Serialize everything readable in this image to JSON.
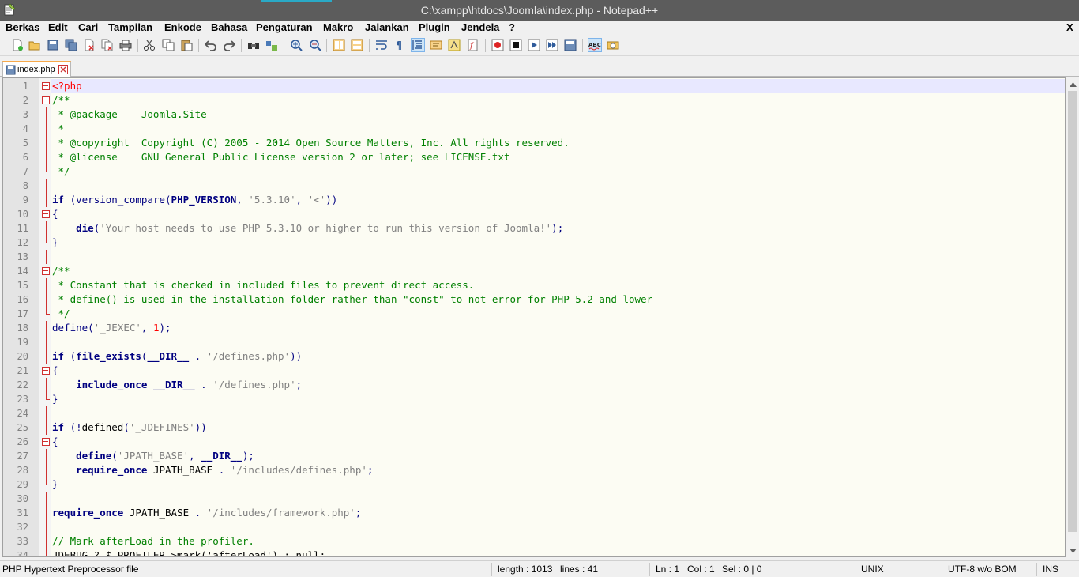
{
  "window": {
    "title": "C:\\xampp\\htdocs\\Joomla\\index.php - Notepad++",
    "close_label": "X"
  },
  "menu": [
    "Berkas",
    "Edit",
    "Cari",
    "Tampilan",
    "Enkode",
    "Bahasa",
    "Pengaturan",
    "Makro",
    "Jalankan",
    "Plugin",
    "Jendela",
    "?"
  ],
  "tab": {
    "label": "index.php"
  },
  "editor": {
    "lines": [
      {
        "n": "1",
        "fold": "start",
        "t": [
          [
            "tg",
            "<?php"
          ]
        ]
      },
      {
        "n": "2",
        "fold": "start",
        "t": [
          [
            "cm",
            "/**"
          ]
        ]
      },
      {
        "n": "3",
        "fold": "line",
        "t": [
          [
            "cm",
            " * @package    Joomla.Site"
          ]
        ]
      },
      {
        "n": "4",
        "fold": "line",
        "t": [
          [
            "cm",
            " *"
          ]
        ]
      },
      {
        "n": "5",
        "fold": "line",
        "t": [
          [
            "cm",
            " * @copyright  Copyright (C) 2005 - 2014 Open Source Matters, Inc. All rights reserved."
          ]
        ]
      },
      {
        "n": "6",
        "fold": "line",
        "t": [
          [
            "cm",
            " * @license    GNU General Public License version 2 or later; see LICENSE.txt"
          ]
        ]
      },
      {
        "n": "7",
        "fold": "end",
        "t": [
          [
            "cm",
            " */"
          ]
        ]
      },
      {
        "n": "8",
        "fold": "line",
        "t": []
      },
      {
        "n": "9",
        "fold": "line",
        "t": [
          [
            "kw",
            "if"
          ],
          [
            "df",
            " "
          ],
          [
            "op",
            "("
          ],
          [
            "op",
            "version_compare"
          ],
          [
            "op",
            "("
          ],
          [
            "kw",
            "PHP_VERSION"
          ],
          [
            "op",
            ","
          ],
          [
            "df",
            " "
          ],
          [
            "st",
            "'5.3.10'"
          ],
          [
            "op",
            ","
          ],
          [
            "df",
            " "
          ],
          [
            "st",
            "'<'"
          ],
          [
            "op",
            "))"
          ]
        ]
      },
      {
        "n": "10",
        "fold": "start",
        "t": [
          [
            "op",
            "{"
          ]
        ]
      },
      {
        "n": "11",
        "fold": "line",
        "t": [
          [
            "df",
            "    "
          ],
          [
            "kw",
            "die"
          ],
          [
            "op",
            "("
          ],
          [
            "st",
            "'Your host needs to use PHP 5.3.10 or higher to run this version of Joomla!'"
          ],
          [
            "op",
            ");"
          ]
        ]
      },
      {
        "n": "12",
        "fold": "end",
        "t": [
          [
            "op",
            "}"
          ]
        ]
      },
      {
        "n": "13",
        "fold": "line",
        "t": []
      },
      {
        "n": "14",
        "fold": "start",
        "t": [
          [
            "cm",
            "/**"
          ]
        ]
      },
      {
        "n": "15",
        "fold": "line",
        "t": [
          [
            "cm",
            " * Constant that is checked in included files to prevent direct access."
          ]
        ]
      },
      {
        "n": "16",
        "fold": "line",
        "t": [
          [
            "cm",
            " * define() is used in the installation folder rather than \"const\" to not error for PHP 5.2 and lower"
          ]
        ]
      },
      {
        "n": "17",
        "fold": "end",
        "t": [
          [
            "cm",
            " */"
          ]
        ]
      },
      {
        "n": "18",
        "fold": "line",
        "t": [
          [
            "op",
            "define"
          ],
          [
            "op",
            "("
          ],
          [
            "st",
            "'_JEXEC'"
          ],
          [
            "op",
            ","
          ],
          [
            "df",
            " "
          ],
          [
            "nm",
            "1"
          ],
          [
            "op",
            ");"
          ]
        ]
      },
      {
        "n": "19",
        "fold": "line",
        "t": []
      },
      {
        "n": "20",
        "fold": "line",
        "t": [
          [
            "kw",
            "if"
          ],
          [
            "df",
            " "
          ],
          [
            "op",
            "("
          ],
          [
            "kw",
            "file_exists"
          ],
          [
            "op",
            "("
          ],
          [
            "kw",
            "__DIR__"
          ],
          [
            "df",
            " "
          ],
          [
            "op",
            "."
          ],
          [
            "df",
            " "
          ],
          [
            "st",
            "'/defines.php'"
          ],
          [
            "op",
            "))"
          ]
        ]
      },
      {
        "n": "21",
        "fold": "start",
        "t": [
          [
            "op",
            "{"
          ]
        ]
      },
      {
        "n": "22",
        "fold": "line",
        "t": [
          [
            "df",
            "    "
          ],
          [
            "kw",
            "include_once"
          ],
          [
            "df",
            " "
          ],
          [
            "kw",
            "__DIR__"
          ],
          [
            "df",
            " "
          ],
          [
            "op",
            "."
          ],
          [
            "df",
            " "
          ],
          [
            "st",
            "'/defines.php'"
          ],
          [
            "op",
            ";"
          ]
        ]
      },
      {
        "n": "23",
        "fold": "end",
        "t": [
          [
            "op",
            "}"
          ]
        ]
      },
      {
        "n": "24",
        "fold": "line",
        "t": []
      },
      {
        "n": "25",
        "fold": "line",
        "t": [
          [
            "kw",
            "if"
          ],
          [
            "df",
            " "
          ],
          [
            "op",
            "(!"
          ],
          [
            "df",
            "defined"
          ],
          [
            "op",
            "("
          ],
          [
            "st",
            "'_JDEFINES'"
          ],
          [
            "op",
            "))"
          ]
        ]
      },
      {
        "n": "26",
        "fold": "start",
        "t": [
          [
            "op",
            "{"
          ]
        ]
      },
      {
        "n": "27",
        "fold": "line",
        "t": [
          [
            "df",
            "    "
          ],
          [
            "kw",
            "define"
          ],
          [
            "op",
            "("
          ],
          [
            "st",
            "'JPATH_BASE'"
          ],
          [
            "op",
            ","
          ],
          [
            "df",
            " "
          ],
          [
            "kw",
            "__DIR__"
          ],
          [
            "op",
            ");"
          ]
        ]
      },
      {
        "n": "28",
        "fold": "line",
        "t": [
          [
            "df",
            "    "
          ],
          [
            "kw",
            "require_once"
          ],
          [
            "df",
            " JPATH_BASE "
          ],
          [
            "op",
            "."
          ],
          [
            "df",
            " "
          ],
          [
            "st",
            "'/includes/defines.php'"
          ],
          [
            "op",
            ";"
          ]
        ]
      },
      {
        "n": "29",
        "fold": "end",
        "t": [
          [
            "op",
            "}"
          ]
        ]
      },
      {
        "n": "30",
        "fold": "line",
        "t": []
      },
      {
        "n": "31",
        "fold": "line",
        "t": [
          [
            "kw",
            "require_once"
          ],
          [
            "df",
            " JPATH_BASE "
          ],
          [
            "op",
            "."
          ],
          [
            "df",
            " "
          ],
          [
            "st",
            "'/includes/framework.php'"
          ],
          [
            "op",
            ";"
          ]
        ]
      },
      {
        "n": "32",
        "fold": "line",
        "t": []
      },
      {
        "n": "33",
        "fold": "line",
        "t": [
          [
            "cm",
            "// Mark afterLoad in the profiler."
          ]
        ]
      },
      {
        "n": "34",
        "fold": "line",
        "t": [
          [
            "df",
            "JDEBUG ? $_PROFILER->mark('afterLoad') : null;"
          ]
        ]
      }
    ]
  },
  "status": {
    "filetype": "PHP Hypertext Preprocessor file",
    "length": "length : 1013",
    "lines": "lines : 41",
    "ln": "Ln : 1",
    "col": "Col : 1",
    "sel": "Sel : 0 | 0",
    "eol": "UNIX",
    "encoding": "UTF-8 w/o BOM",
    "mode": "INS"
  },
  "colors": {
    "accent": "#2aa9c6",
    "keyword": "#000080",
    "comment": "#008000",
    "string": "#808080",
    "number": "#ff0000",
    "tag": "#ff0000",
    "caret_line": "#e8e8ff"
  },
  "toolbar": [
    "new-file-icon",
    "open-file-icon",
    "save-icon",
    "save-all-icon",
    "close-icon",
    "close-all-icon",
    "print-icon",
    "cut-icon",
    "copy-icon",
    "paste-icon",
    "undo-icon",
    "redo-icon",
    "find-icon",
    "replace-icon",
    "zoom-in-icon",
    "zoom-out-icon",
    "sync-vertical-icon",
    "sync-horizontal-icon",
    "word-wrap-icon",
    "show-all-chars-icon",
    "indent-guide-icon",
    "user-language-icon",
    "doc-map-icon",
    "function-list-icon",
    "record-macro-icon",
    "stop-macro-icon",
    "play-macro-icon",
    "run-macro-multiple-icon",
    "save-macro-icon",
    "spell-check-icon",
    "spell-check-auto-icon"
  ]
}
